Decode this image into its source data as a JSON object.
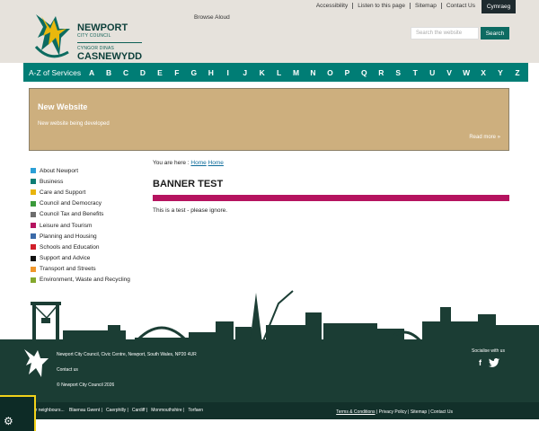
{
  "header": {
    "logo": {
      "line1": "NEWPORT",
      "line2": "CITY COUNCIL",
      "line3": "CYNGOR DINAS",
      "line4": "CASNEWYDD"
    },
    "browse_aloud": "Browse Aloud",
    "top_links": [
      "Accessibility",
      "Listen to this page",
      "Sitemap",
      "Contact Us"
    ],
    "language_button": "Cymraeg",
    "search": {
      "placeholder": "Search the website",
      "button": "Search"
    }
  },
  "az_nav": {
    "label": "A-Z of Services",
    "letters": [
      "A",
      "B",
      "C",
      "D",
      "E",
      "F",
      "G",
      "H",
      "I",
      "J",
      "K",
      "L",
      "M",
      "N",
      "O",
      "P",
      "Q",
      "R",
      "S",
      "T",
      "U",
      "V",
      "W",
      "X",
      "Y",
      "Z"
    ]
  },
  "banner": {
    "title": "New Website",
    "subtitle": "New website being developed",
    "more": "Read more »"
  },
  "sidebar": {
    "items": [
      {
        "label": "About Newport",
        "color": "#2b9fd6"
      },
      {
        "label": "Business",
        "color": "#0d7d74"
      },
      {
        "label": "Care and Support",
        "color": "#e8b40c"
      },
      {
        "label": "Council and Democracy",
        "color": "#3a9a3a"
      },
      {
        "label": "Council Tax and Benefits",
        "color": "#6d6d6d"
      },
      {
        "label": "Leisure and Tourism",
        "color": "#b5135f"
      },
      {
        "label": "Planning and Housing",
        "color": "#3b6aa8"
      },
      {
        "label": "Schools and Education",
        "color": "#d11f2a"
      },
      {
        "label": "Support and Advice",
        "color": "#111111"
      },
      {
        "label": "Transport and Streets",
        "color": "#f0962a"
      },
      {
        "label": "Environment, Waste and Recycling",
        "color": "#84a82c"
      }
    ]
  },
  "main": {
    "breadcrumb_prefix": "You are here :",
    "breadcrumb_links": [
      "Home",
      "Home"
    ],
    "title": "BANNER TEST",
    "body": "This is a test - please ignore."
  },
  "footer": {
    "address": "Newport City Council, Civic Centre, Newport, South Wales, NP20 4UR",
    "contact": "Contact us",
    "copyright": "© Newport City Council 2026",
    "social_label": "Socialise with us",
    "social": [
      "facebook-icon",
      "twitter-icon"
    ],
    "neighbours_label": "Our neighbours...",
    "neighbours": [
      "Blaenau Gwent",
      "Caerphilly",
      "Cardiff",
      "Monmouthshire",
      "Torfaen"
    ],
    "legal_links": [
      "Terms & Conditions",
      "Privacy Policy",
      "Sitemap",
      "Contact Us"
    ]
  },
  "colors": {
    "header_bg": "#e6e2dc",
    "accent_teal": "#007d75",
    "banner_tan": "#cdaf7e",
    "title_bar": "#b5135f",
    "footer_dark": "#1b3d34",
    "cookie_border": "#f2d21a"
  },
  "cookie": {
    "icon": "gear-icon"
  }
}
